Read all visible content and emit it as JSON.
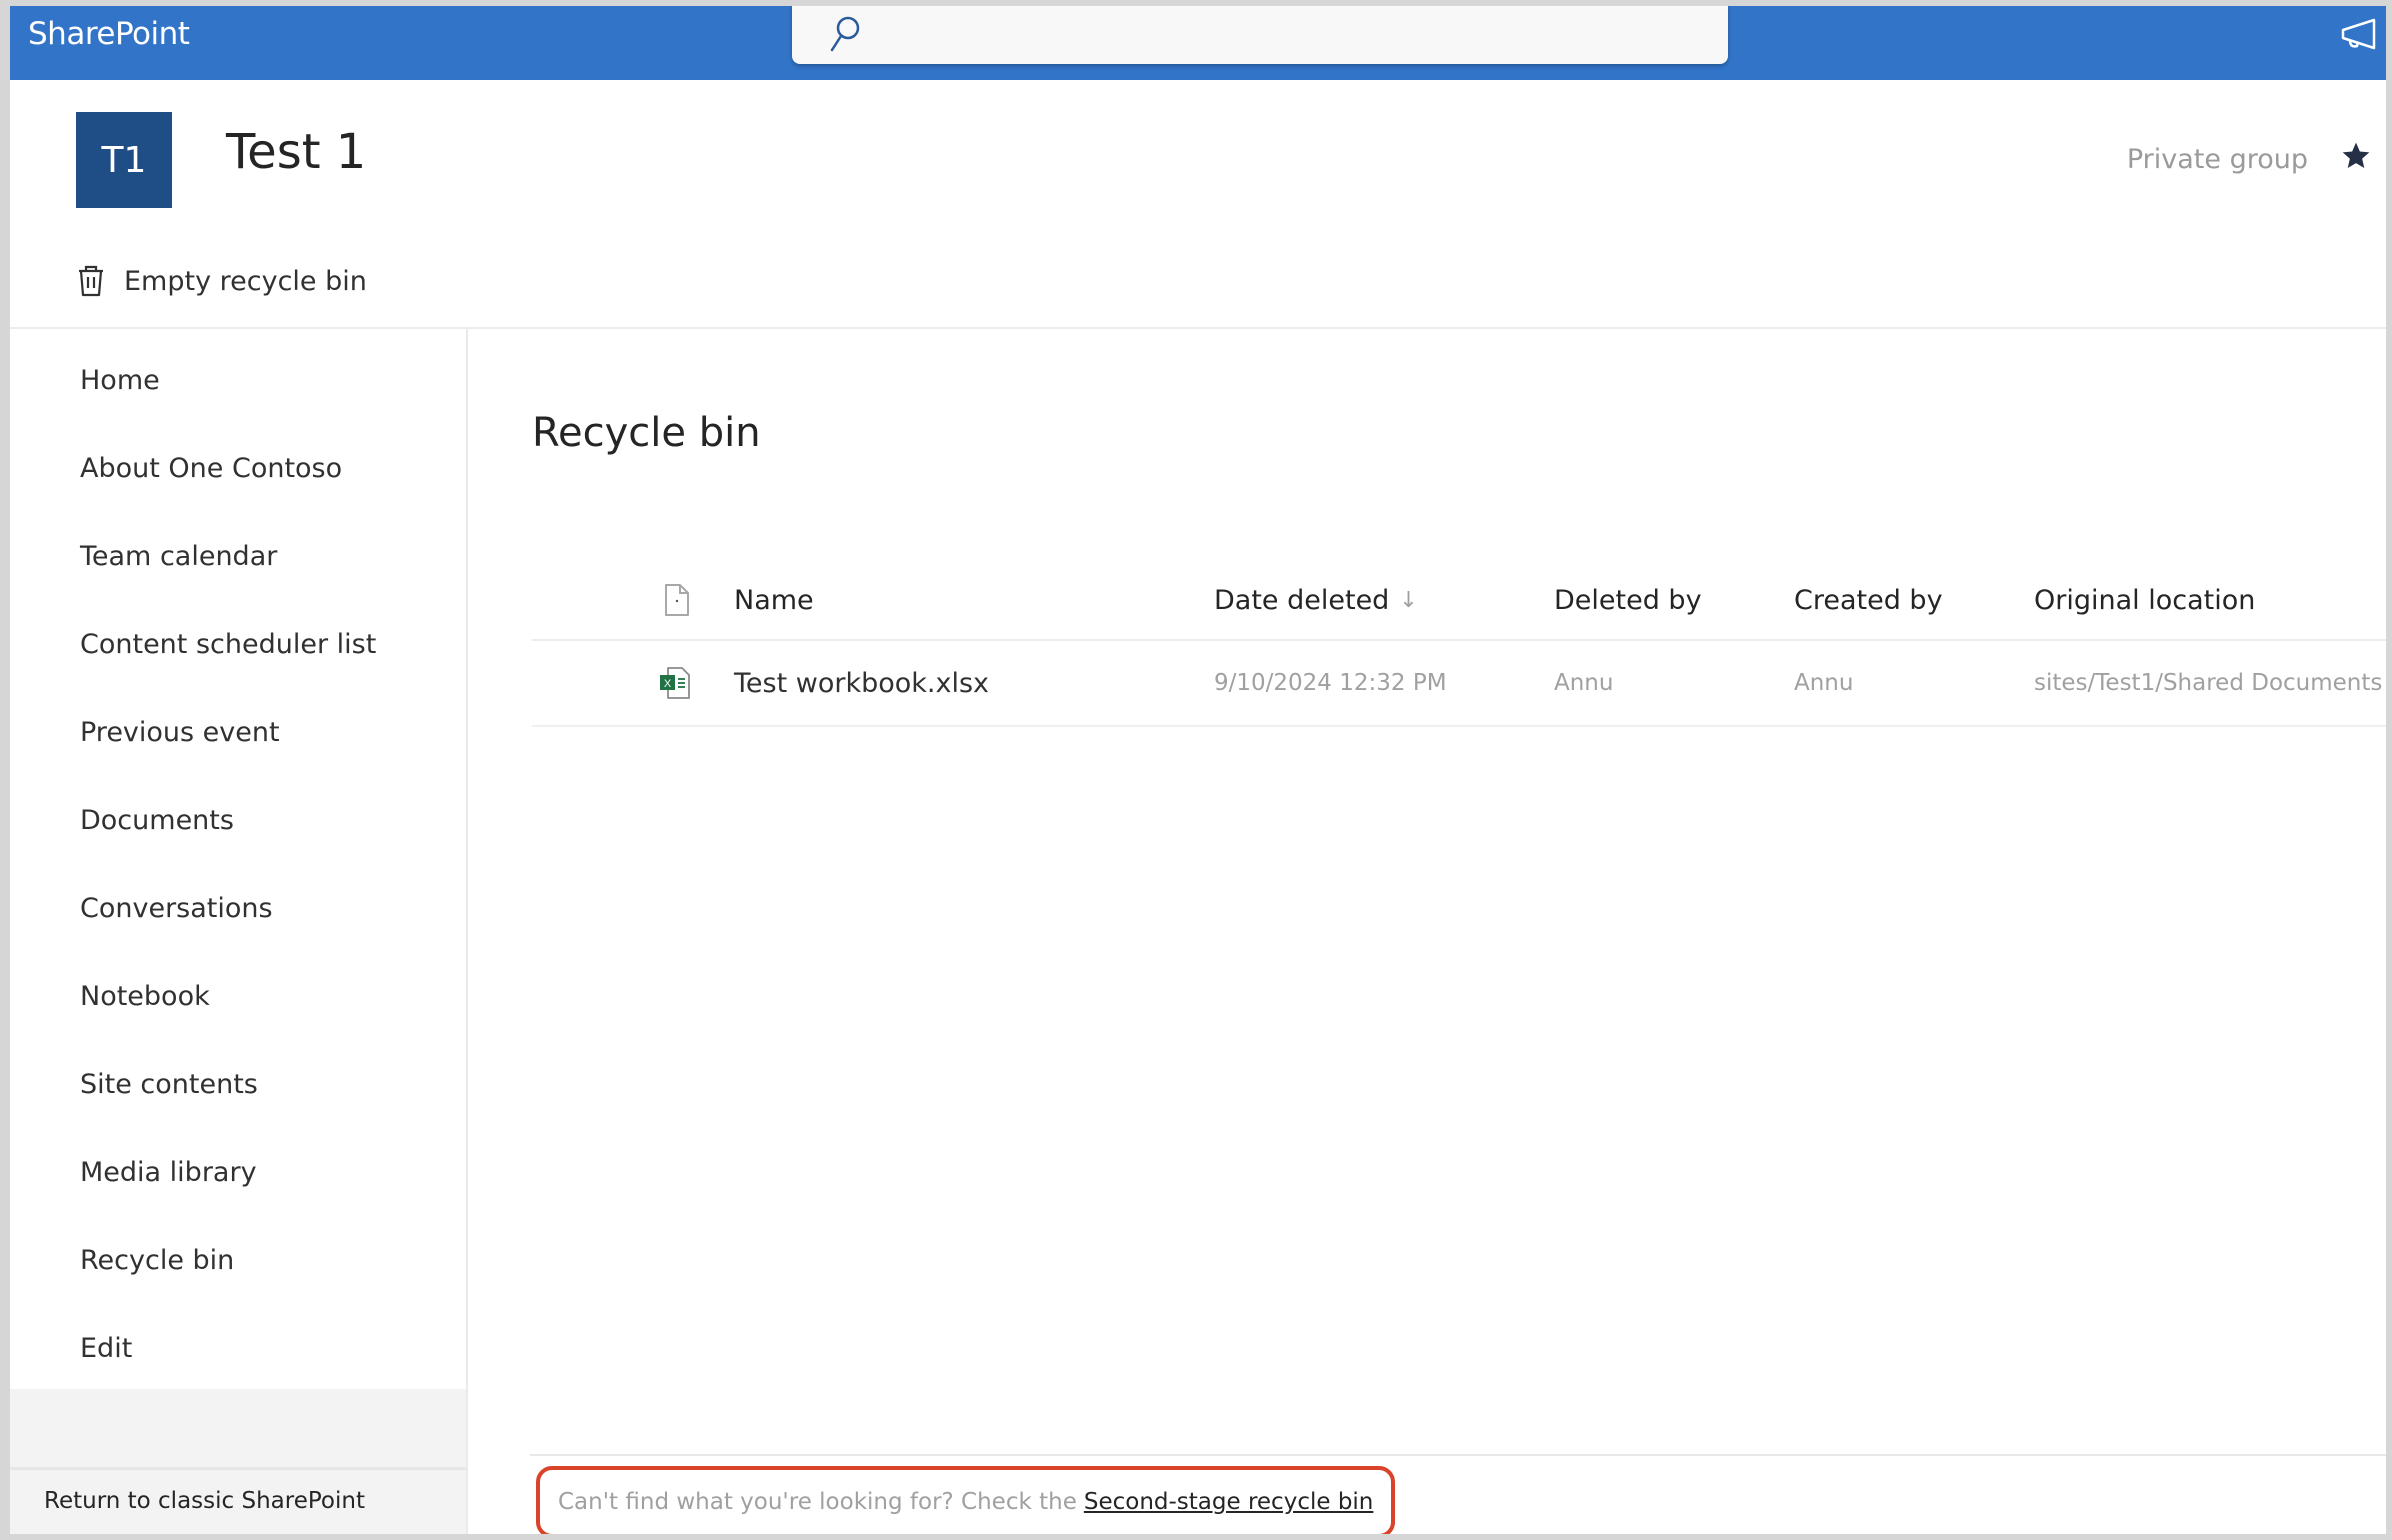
{
  "header": {
    "brand": "SharePoint",
    "search_placeholder": "",
    "icons": {
      "search": "search-icon",
      "feedback": "megaphone-icon"
    }
  },
  "site": {
    "logo_initials": "T1",
    "title": "Test 1",
    "privacy": "Private group",
    "follow_icon": "star-icon"
  },
  "commandbar": {
    "empty_recycle_bin": "Empty recycle bin"
  },
  "sidebar": {
    "items": [
      {
        "label": "Home"
      },
      {
        "label": "About One Contoso"
      },
      {
        "label": "Team calendar"
      },
      {
        "label": "Content scheduler list"
      },
      {
        "label": "Previous event"
      },
      {
        "label": "Documents"
      },
      {
        "label": "Conversations"
      },
      {
        "label": "Notebook"
      },
      {
        "label": "Site contents"
      },
      {
        "label": "Media library"
      },
      {
        "label": "Recycle bin"
      },
      {
        "label": "Edit"
      }
    ],
    "return_classic": "Return to classic SharePoint"
  },
  "main": {
    "title": "Recycle bin",
    "table": {
      "columns": [
        "Name",
        "Date deleted",
        "Deleted by",
        "Created by",
        "Original location"
      ],
      "sort_indicator": "↓",
      "rows": [
        {
          "name": "Test workbook.xlsx",
          "date_deleted": "9/10/2024 12:32 PM",
          "deleted_by": "Annu",
          "created_by": "Annu",
          "original_location": "sites/Test1/Shared Documents",
          "file_type": "excel"
        }
      ]
    },
    "footer": {
      "text": "Can't find what you're looking for? Check the",
      "link": "Second-stage recycle bin",
      "highlight_color": "#d9432a"
    }
  },
  "colors": {
    "suite_bar": "#3174c8",
    "site_logo": "#1f4e87",
    "excel_green": "#217346"
  }
}
